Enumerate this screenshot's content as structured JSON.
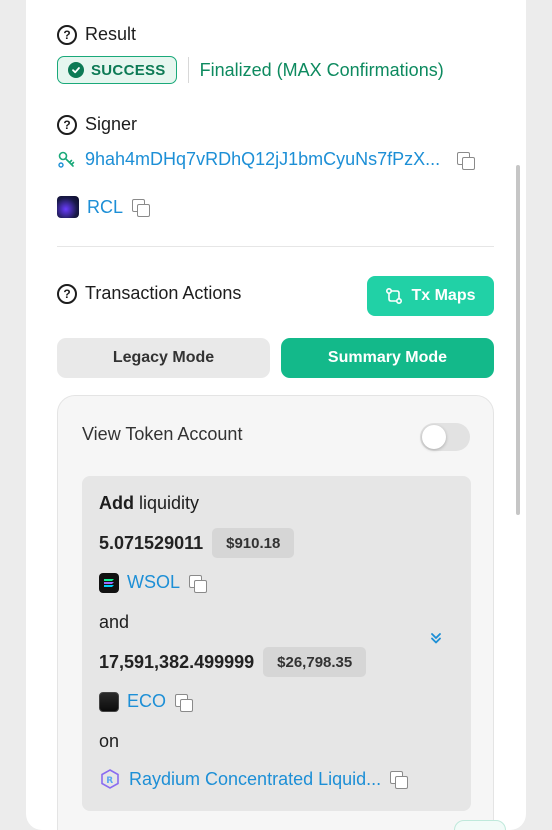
{
  "result": {
    "label": "Result",
    "status_badge": "SUCCESS",
    "finalized_text": "Finalized (MAX Confirmations)"
  },
  "signer": {
    "label": "Signer",
    "address": "9hah4mDHq7vRDhQ12jJ1bmCyuNs7fPzX...",
    "token_symbol": "RCL"
  },
  "actions": {
    "label": "Transaction Actions",
    "tx_maps_button": "Tx Maps",
    "legacy_mode_button": "Legacy Mode",
    "summary_mode_button": "Summary Mode",
    "view_token_account_label": "View Token Account",
    "view_token_account_on": false,
    "summary": {
      "verb": "Add",
      "verb_rest": "liquidity",
      "amount1": "5.071529011",
      "amount1_usd": "$910.18",
      "token1": "WSOL",
      "connector1": "and",
      "amount2": "17,591,382.499999",
      "amount2_usd": "$26,798.35",
      "token2": "ECO",
      "connector2": "on",
      "protocol": "Raydium Concentrated Liquid..."
    }
  },
  "colors": {
    "accent_green": "#21d1a6",
    "summary_green": "#13b98a",
    "link_blue": "#1d8fd6",
    "success_text": "#0d7a55"
  },
  "icons": {
    "help": "question-circle-icon",
    "check": "check-circle-icon",
    "signer": "signer-key-icon",
    "copy": "copy-icon",
    "tx_maps": "route-icon",
    "expand": "double-chevron-down-icon",
    "wsol": "wsol-token-icon",
    "eco": "eco-token-icon",
    "rcl": "rcl-token-icon",
    "raydium": "raydium-logo-icon"
  }
}
